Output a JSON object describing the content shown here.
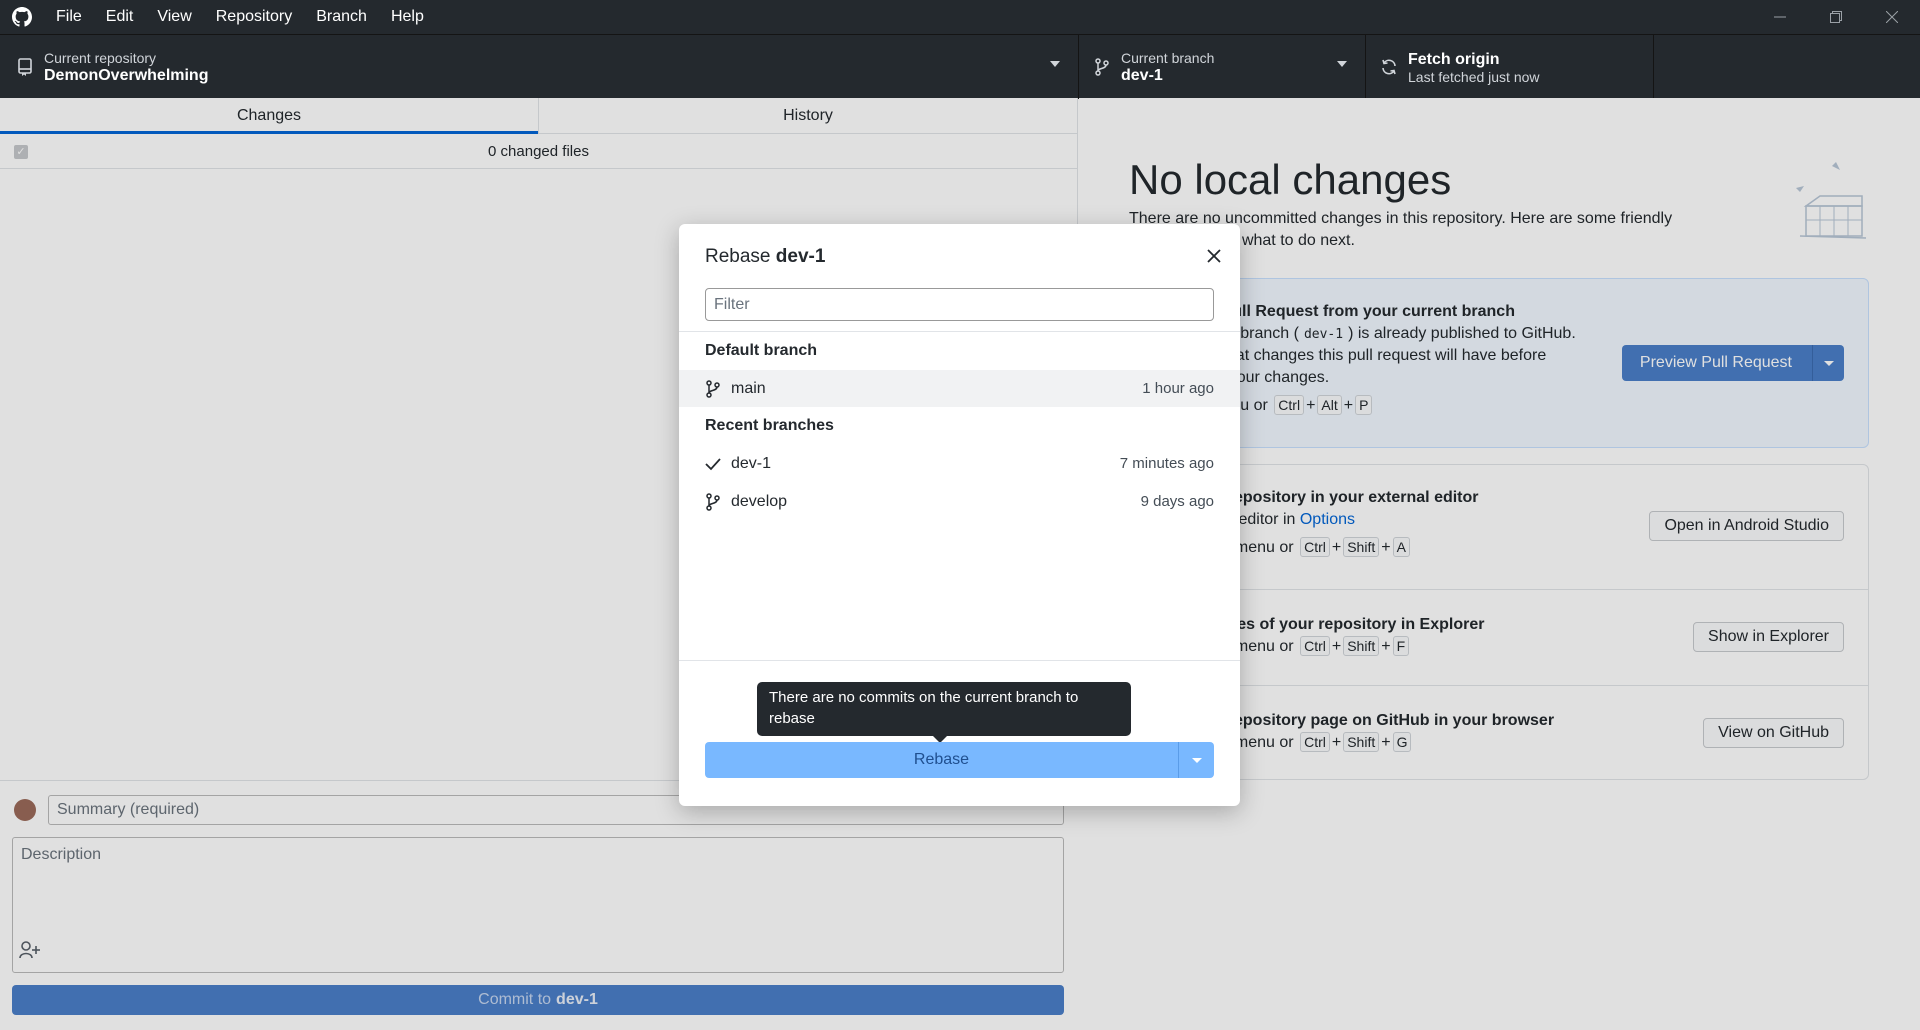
{
  "menu": [
    "File",
    "Edit",
    "View",
    "Repository",
    "Branch",
    "Help"
  ],
  "toolbar": {
    "repo_label": "Current repository",
    "repo_name": "DemonOverwhelming",
    "branch_label": "Current branch",
    "branch_name": "dev-1",
    "fetch_title": "Fetch origin",
    "fetch_sub": "Last fetched just now"
  },
  "left": {
    "tabs": [
      "Changes",
      "History"
    ],
    "changed_files": "0 changed files",
    "summary_placeholder": "Summary (required)",
    "description_placeholder": "Description",
    "commit_prefix": "Commit to",
    "commit_branch": "dev-1"
  },
  "right": {
    "title": "No local changes",
    "subtitle": "There are no uncommitted changes in this repository. Here are some friendly suggestions for what to do next.",
    "pr": {
      "title": "Create a Pull Request from your current branch",
      "desc1a": "The current branch (",
      "branch_code": "dev-1",
      "desc1b": ") is already published to GitHub.",
      "desc2": "Preview what changes this pull request will have before proposing your changes.",
      "shortcut_prefix": "Branch menu or",
      "keys": [
        "Ctrl",
        "Alt",
        "P"
      ],
      "button": "Preview Pull Request"
    },
    "editor": {
      "title": "Open the repository in your external editor",
      "desc_prefix": "Select your editor in",
      "desc_link": "Options",
      "shortcut_prefix": "Repository menu or",
      "keys": [
        "Ctrl",
        "Shift",
        "A"
      ],
      "button": "Open in Android Studio"
    },
    "explorer": {
      "title": "View the files of your repository in Explorer",
      "shortcut_prefix": "Repository menu or",
      "keys": [
        "Ctrl",
        "Shift",
        "F"
      ],
      "button": "Show in Explorer"
    },
    "github": {
      "title": "Open the repository page on GitHub in your browser",
      "shortcut_prefix": "Repository menu or",
      "keys": [
        "Ctrl",
        "Shift",
        "G"
      ],
      "button": "View on GitHub"
    }
  },
  "modal": {
    "title_prefix": "Rebase",
    "title_branch": "dev-1",
    "filter_placeholder": "Filter",
    "default_heading": "Default branch",
    "recent_heading": "Recent branches",
    "default_branches": [
      {
        "name": "main",
        "time": "1 hour ago",
        "icon": "branch-icon"
      }
    ],
    "recent_branches": [
      {
        "name": "dev-1",
        "time": "7 minutes ago",
        "icon": "check-icon"
      },
      {
        "name": "develop",
        "time": "9 days ago",
        "icon": "branch-icon"
      }
    ],
    "tooltip": "There are no commits on the current branch to rebase",
    "rebase_button": "Rebase"
  },
  "colors": {
    "titlebar": "#24292e",
    "accent": "#0366d6",
    "primary_button": "#4a7fc9",
    "rebase_button": "#79b8ff"
  }
}
